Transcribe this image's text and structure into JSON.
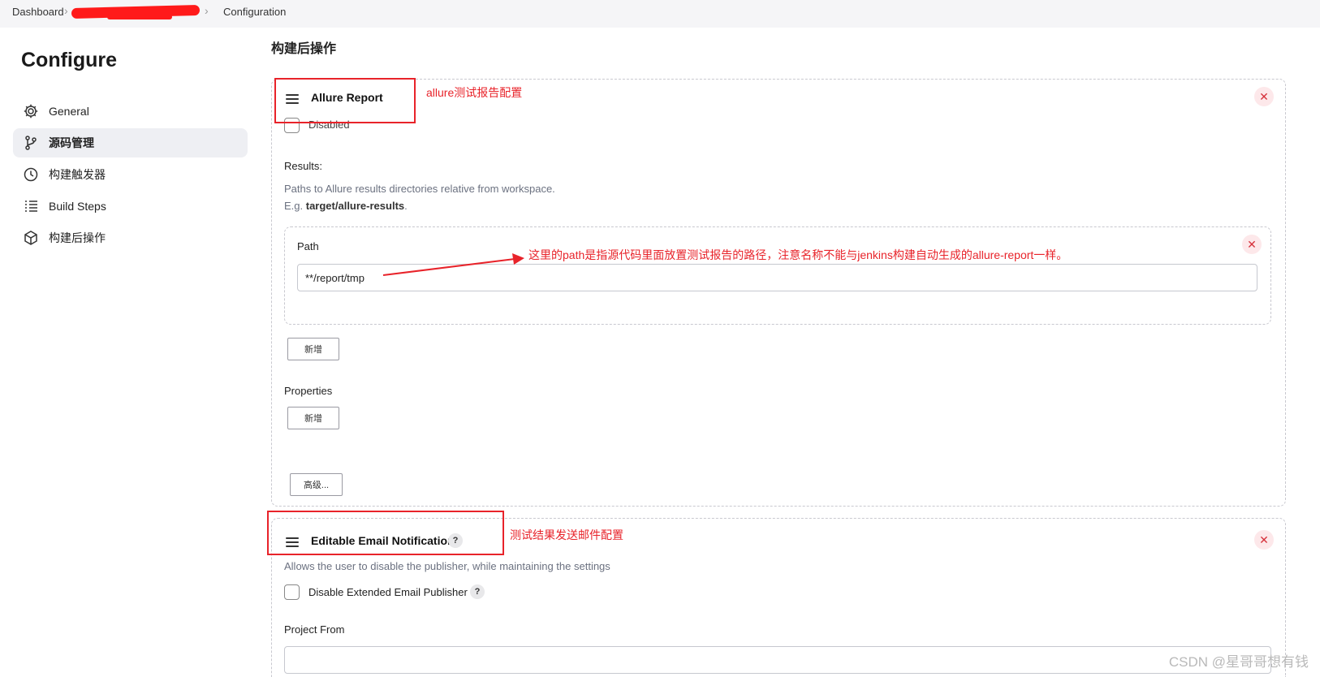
{
  "breadcrumb": {
    "items": [
      "Dashboard",
      "Configuration"
    ]
  },
  "sidebar": {
    "title": "Configure",
    "items": [
      {
        "label": "General",
        "icon": "gear-icon"
      },
      {
        "label": "源码管理",
        "icon": "branch-icon",
        "active": true
      },
      {
        "label": "构建触发器",
        "icon": "clock-icon"
      },
      {
        "label": "Build Steps",
        "icon": "list-icon"
      },
      {
        "label": "构建后操作",
        "icon": "package-icon"
      }
    ]
  },
  "main": {
    "section_title": "构建后操作",
    "allure": {
      "title": "Allure Report",
      "disabled_label": "Disabled",
      "results_label": "Results:",
      "results_help_line1": "Paths to Allure results directories relative from workspace.",
      "results_help_prefix": "E.g. ",
      "results_help_bold": "target/allure-results",
      "results_help_suffix": ".",
      "path_label": "Path",
      "path_value": "**/report/tmp",
      "add_button": "新增",
      "properties_label": "Properties",
      "properties_add_button": "新增",
      "advanced_button": "高级..."
    },
    "email": {
      "title": "Editable Email Notification",
      "description": "Allows the user to disable the publisher, while maintaining the settings",
      "disable_label": "Disable Extended Email Publisher",
      "project_from_label": "Project From",
      "project_from_value": ""
    }
  },
  "annotations": {
    "allure_note": "allure测试报告配置",
    "path_note": "这里的path是指源代码里面放置测试报告的路径，注意名称不能与jenkins构建自动生成的allure-report一样。",
    "email_note": "测试结果发送邮件配置"
  },
  "watermark": "CSDN @星哥哥想有钱",
  "colors": {
    "annotation_red": "#e8232a",
    "active_nav_bg": "#eeeff3",
    "close_red": "#d6313b"
  }
}
